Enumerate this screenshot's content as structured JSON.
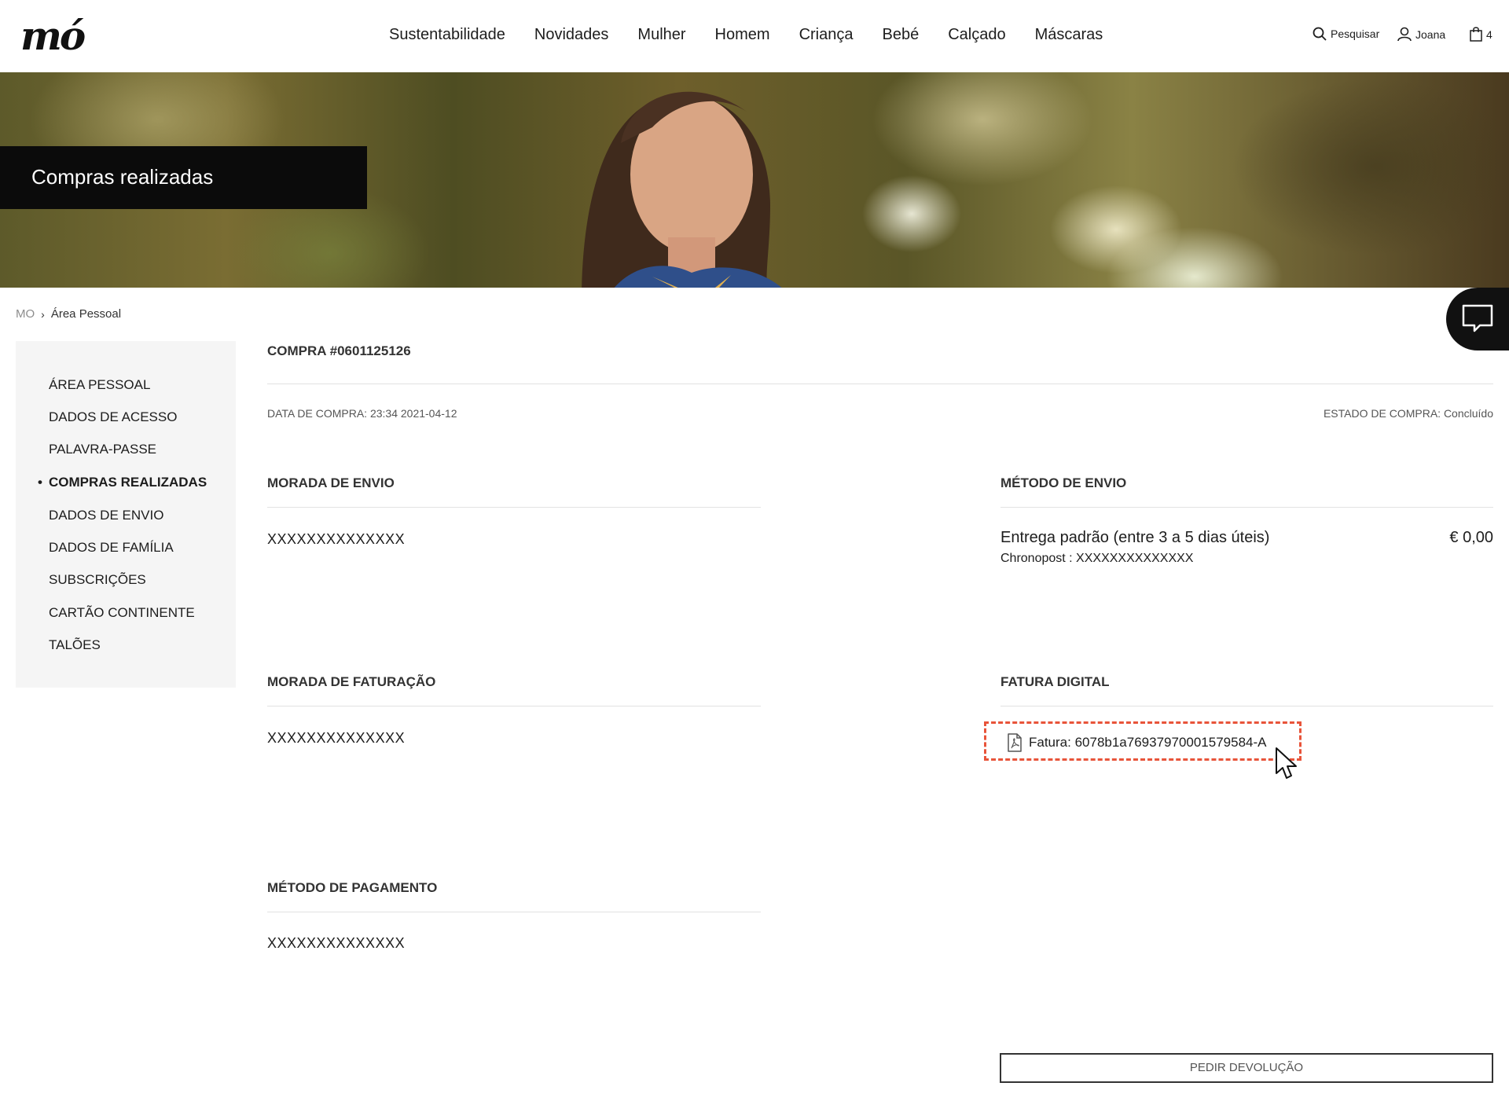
{
  "header": {
    "logo": "mó",
    "nav": [
      "Sustentabilidade",
      "Novidades",
      "Mulher",
      "Homem",
      "Criança",
      "Bebé",
      "Calçado",
      "Máscaras"
    ],
    "search_label": "Pesquisar",
    "user_label": "Joana",
    "cart_count": "4"
  },
  "hero": {
    "title": "Compras realizadas"
  },
  "breadcrumb": {
    "root": "MO",
    "separator": "›",
    "current": "Área Pessoal"
  },
  "sidebar": {
    "items": [
      {
        "label": "ÁREA PESSOAL",
        "active": false
      },
      {
        "label": "DADOS DE ACESSO",
        "active": false
      },
      {
        "label": "PALAVRA-PASSE",
        "active": false
      },
      {
        "label": "COMPRAS REALIZADAS",
        "active": true
      },
      {
        "label": "DADOS DE ENVIO",
        "active": false
      },
      {
        "label": "DADOS DE FAMÍLIA",
        "active": false
      },
      {
        "label": "SUBSCRIÇÕES",
        "active": false
      },
      {
        "label": "CARTÃO CONTINENTE",
        "active": false
      },
      {
        "label": "TALÕES",
        "active": false
      }
    ]
  },
  "order": {
    "title": "COMPRA #0601125126",
    "date": "DATA DE COMPRA: 23:34 2021-04-12",
    "status": "ESTADO DE COMPRA: Concluído",
    "shipping_address": {
      "title": "MORADA DE ENVIO",
      "value": "XXXXXXXXXXXXXX"
    },
    "shipping_method": {
      "title": "MÉTODO DE ENVIO",
      "name": "Entrega padrão (entre 3 a 5 dias úteis)",
      "carrier": "Chronopost : XXXXXXXXXXXXXX",
      "price": "€ 0,00"
    },
    "billing_address": {
      "title": "MORADA DE FATURAÇÃO",
      "value": "XXXXXXXXXXXXXX"
    },
    "digital_invoice": {
      "title": "FATURA DIGITAL",
      "link": "Fatura: 6078b1a76937970001579584-A"
    },
    "payment_method": {
      "title": "MÉTODO DE PAGAMENTO",
      "value": "XXXXXXXXXXXXXX"
    },
    "return_button": "PEDIR DEVOLUÇÃO"
  },
  "colors": {
    "accent_highlight": "#e8543a",
    "hero_title_bg": "#0b0b0b",
    "sidebar_bg": "#f5f5f5"
  },
  "icons": [
    "search-icon",
    "user-icon",
    "bag-icon",
    "chat-icon",
    "pdf-icon",
    "cursor-icon",
    "chevron-right-icon"
  ]
}
